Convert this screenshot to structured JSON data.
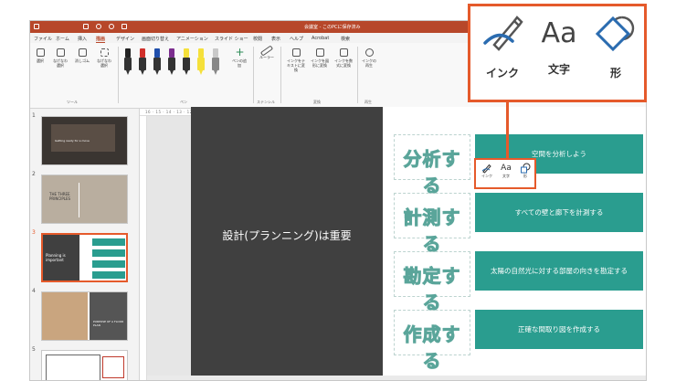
{
  "window": {
    "title": "会議室 - このPCに保存済み"
  },
  "tabs": [
    "ファイル",
    "ホーム",
    "挿入",
    "描画",
    "デザイン",
    "画面切り替え",
    "アニメーション",
    "スライド ショー",
    "校閲",
    "表示",
    "ヘルプ",
    "Acrobat",
    "検索"
  ],
  "ribbon": {
    "tools": [
      "選択",
      "なげなわ選択",
      "消しゴム",
      "なげなわ選択"
    ],
    "groups": {
      "tools": "ツール",
      "pens": "ペン",
      "stencils": "ステンシル",
      "convert": "変換",
      "replay": "再生"
    },
    "pen_colors": [
      "#222222",
      "#d0302b",
      "#1f4eab",
      "#7b2d8e",
      "#f5e03a",
      "#f5e03a",
      "#c9c9c9"
    ],
    "add_pen": "ペンの追加",
    "ruler": "ルーラー",
    "ink_to_text": "インクをテキストに変換",
    "ink_to_shape": "インクを図形に変換",
    "ink_to_math": "インクを数式に変換",
    "ink_replay": "インクの再生"
  },
  "ruler": {
    "ticks": "16 · 15 · 14 · 13 · 12 · 11 · 10 · 9 · 8 · 7 · 6 · 5 · 4 · 3 · 2 · 1 · 0 · 1 · 2 · 3 · 4 · 5 · 6 · 7 · 8 · 9 · 10 · 11 · 12 · 13 · 14 · 15 · 16"
  },
  "thumbnails": [
    {
      "num": "1",
      "title": "Getting ready for a move"
    },
    {
      "num": "2",
      "title": "THE THREE PRINCIPLES"
    },
    {
      "num": "3",
      "title": "Planning is important"
    },
    {
      "num": "4",
      "title": "PURPOSE OF A FLOOR PLAN"
    },
    {
      "num": "5",
      "title": ""
    }
  ],
  "slide": {
    "title": "設計(プランニング)は重要",
    "handwritten": [
      "分析する",
      "計測する",
      "勘定する",
      "作成する"
    ],
    "boxes": [
      "空間を分析しよう",
      "すべての壁と廊下を計測する",
      "太陽の自然光に対する部屋の向きを勘定する",
      "正確な間取り図を作成する"
    ]
  },
  "mini_toolbar": {
    "ink": "インク",
    "text": "文字",
    "shape": "形"
  },
  "callout": {
    "ink": "インク",
    "text": "文字",
    "shape": "形",
    "text_glyph": "Aa"
  },
  "colors": {
    "accent": "#e55a2b",
    "title_bar": "#b7472a",
    "teal": "#2a9d8f",
    "dark": "#404040"
  }
}
